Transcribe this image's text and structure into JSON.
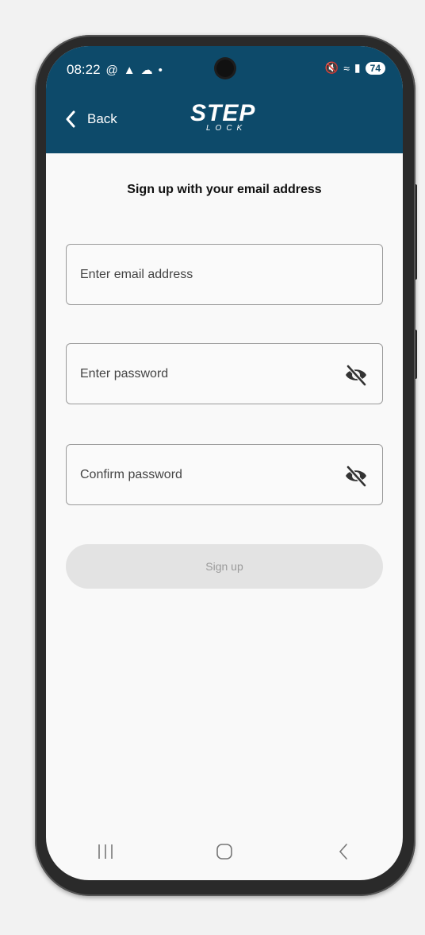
{
  "status_bar": {
    "time": "08:22",
    "battery": "74"
  },
  "header": {
    "back_label": "Back",
    "logo_main": "STEP",
    "logo_sub": "LOCK",
    "bg_color": "#0d4a6a"
  },
  "form": {
    "title": "Sign up with your email address",
    "email_placeholder": "Enter email address",
    "password_placeholder": "Enter password",
    "confirm_placeholder": "Confirm password",
    "submit_label": "Sign up"
  },
  "nav": {
    "recents_icon": "recents-icon",
    "home_icon": "home-icon",
    "back_icon": "back-icon"
  }
}
